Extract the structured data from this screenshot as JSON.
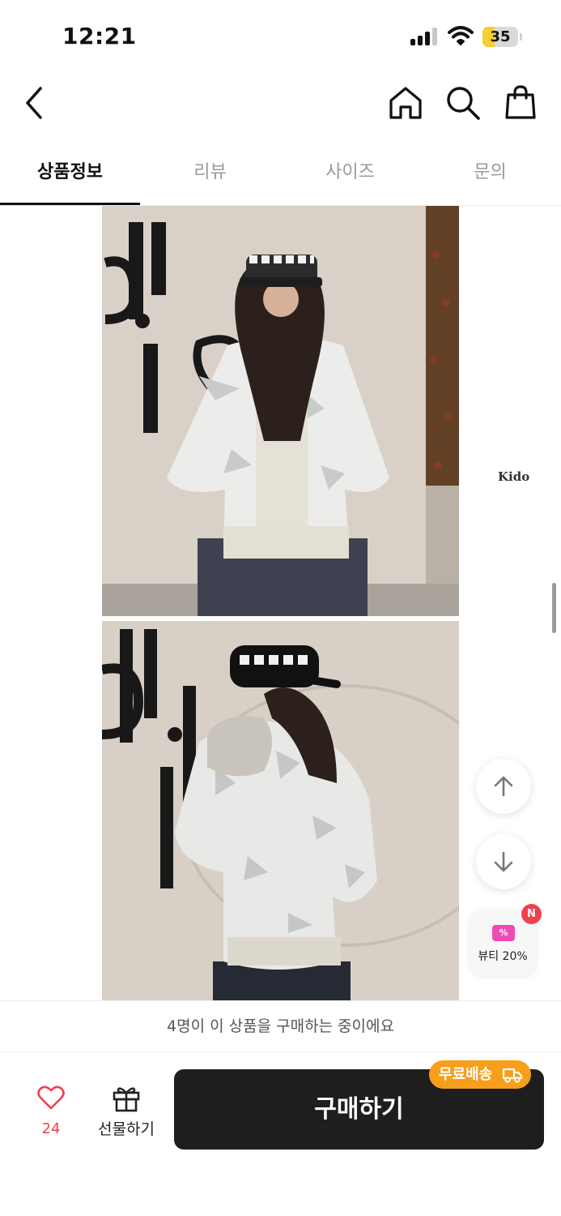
{
  "status_bar": {
    "time": "12:21",
    "battery_level": "35",
    "battery_fraction": 0.35,
    "icons": [
      "cellular-signal-icon",
      "wifi-icon",
      "battery-icon"
    ]
  },
  "header": {
    "icons": [
      "back-arrow-icon",
      "home-icon",
      "search-icon",
      "shopping-bag-icon"
    ]
  },
  "tabs": [
    {
      "label": "상품정보",
      "active": true
    },
    {
      "label": "리뷰",
      "active": false
    },
    {
      "label": "사이즈",
      "active": false
    },
    {
      "label": "문의",
      "active": false
    }
  ],
  "content": {
    "side_brand": "Kido",
    "photos": [
      "jacket-front-photo",
      "jacket-back-photo"
    ]
  },
  "floating": {
    "icons": [
      "arrow-up-icon",
      "arrow-down-icon"
    ],
    "beauty_chip": {
      "badge": "N",
      "coupon_symbol": "%",
      "label": "뷰티 20%"
    }
  },
  "notice": {
    "text": "4명이 이 상품을 구매하는 중이에요"
  },
  "bottom_bar": {
    "like_count": "24",
    "gift_label": "선물하기",
    "buy_label": "구매하기",
    "free_shipping_label": "무료배송"
  },
  "colors": {
    "accent_red": "#ef4050",
    "free_shipping_orange": "#f79e1b",
    "buy_button": "#1e1e1e",
    "battery_yellow": "#f6cf2e",
    "coupon_pink": "#f04bb5"
  }
}
